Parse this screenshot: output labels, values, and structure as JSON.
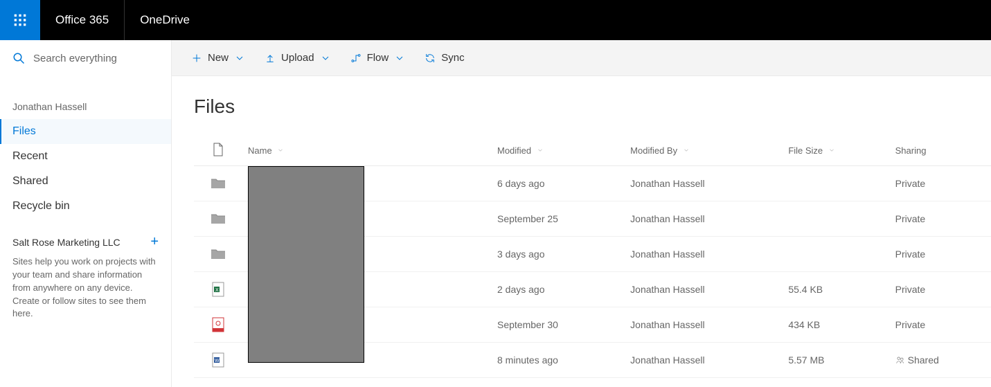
{
  "topbar": {
    "suite": "Office 365",
    "app": "OneDrive"
  },
  "search": {
    "placeholder": "Search everything"
  },
  "owner": "Jonathan Hassell",
  "nav": {
    "items": [
      {
        "label": "Files",
        "active": true
      },
      {
        "label": "Recent"
      },
      {
        "label": "Shared"
      },
      {
        "label": "Recycle bin"
      }
    ]
  },
  "section": {
    "label": "Salt Rose Marketing LLC"
  },
  "helptext": "Sites help you work on projects with your team and share information from anywhere on any device. Create or follow sites to see them here.",
  "cmdbar": {
    "new": "New",
    "upload": "Upload",
    "flow": "Flow",
    "sync": "Sync"
  },
  "page": {
    "title": "Files",
    "columns": {
      "name": "Name",
      "modified": "Modified",
      "modifiedby": "Modified By",
      "size": "File Size",
      "sharing": "Sharing"
    }
  },
  "rows": [
    {
      "type": "folder",
      "modified": "6 days ago",
      "by": "Jonathan Hassell",
      "size": "",
      "sharing": "Private"
    },
    {
      "type": "folder",
      "modified": "September 25",
      "by": "Jonathan Hassell",
      "size": "",
      "sharing": "Private"
    },
    {
      "type": "folder",
      "modified": "3 days ago",
      "by": "Jonathan Hassell",
      "size": "",
      "sharing": "Private"
    },
    {
      "type": "excel",
      "modified": "2 days ago",
      "by": "Jonathan Hassell",
      "size": "55.4 KB",
      "sharing": "Private"
    },
    {
      "type": "pdf",
      "modified": "September 30",
      "by": "Jonathan Hassell",
      "size": "434 KB",
      "sharing": "Private"
    },
    {
      "type": "word",
      "modified": "8 minutes ago",
      "by": "Jonathan Hassell",
      "size": "5.57 MB",
      "sharing": "Shared",
      "sharedIcon": true
    }
  ]
}
